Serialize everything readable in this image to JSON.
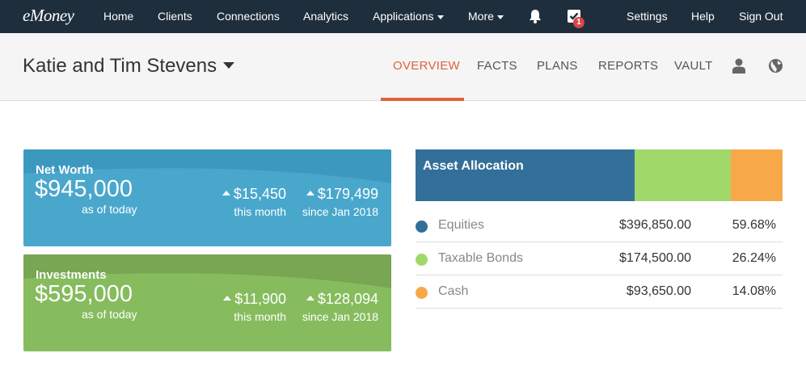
{
  "topnav": {
    "logo": "eMoney",
    "items": [
      "Home",
      "Clients",
      "Connections",
      "Analytics",
      "Applications",
      "More"
    ],
    "task_badge": "1",
    "right_items": [
      "Settings",
      "Help",
      "Sign Out"
    ]
  },
  "client": {
    "name": "Katie and Tim Stevens",
    "tabs": [
      "OVERVIEW",
      "FACTS",
      "PLANS",
      "REPORTS",
      "VAULT"
    ]
  },
  "net_worth": {
    "title": "Net Worth",
    "value": "$945,000",
    "sub": "as of today",
    "month_value": "$15,450",
    "month_label": "this month",
    "since_value": "$179,499",
    "since_label": "since Jan 2018"
  },
  "investments": {
    "title": "Investments",
    "value": "$595,000",
    "sub": "as of today",
    "month_value": "$11,900",
    "month_label": "this month",
    "since_value": "$128,094",
    "since_label": "since Jan 2018"
  },
  "allocation": {
    "title": "Asset Allocation",
    "rows": [
      {
        "name": "Equities",
        "amount": "$396,850.00",
        "pct": "59.68%",
        "share": 59.68,
        "color": "#336f99"
      },
      {
        "name": "Taxable Bonds",
        "amount": "$174,500.00",
        "pct": "26.24%",
        "share": 26.24,
        "color": "#a0d86a"
      },
      {
        "name": "Cash",
        "amount": "$93,650.00",
        "pct": "14.08%",
        "share": 14.08,
        "color": "#f7a94a"
      }
    ]
  },
  "colors": {
    "nav_bg": "#1f2e3d",
    "accent": "#e0623a",
    "net_worth_card": "#4aa7cc",
    "investments_card": "#86bc5e"
  }
}
